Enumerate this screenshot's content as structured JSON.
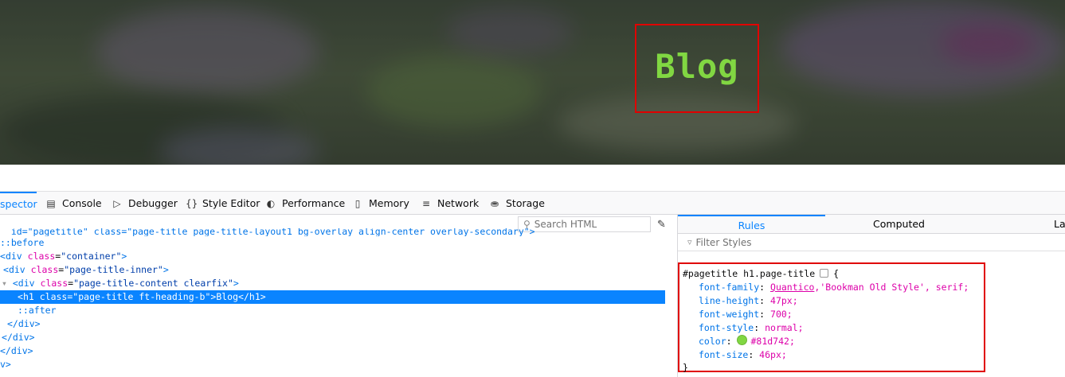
{
  "page": {
    "title": "Blog",
    "title_color": "#81d742"
  },
  "devtools": {
    "tabs": [
      {
        "label": "spector",
        "icon": "",
        "selected": true
      },
      {
        "label": "Console",
        "icon": "console-icon"
      },
      {
        "label": "Debugger",
        "icon": "debugger-icon"
      },
      {
        "label": "Style Editor",
        "icon": "braces-icon"
      },
      {
        "label": "Performance",
        "icon": "gauge-icon"
      },
      {
        "label": "Memory",
        "icon": "memory-chip-icon"
      },
      {
        "label": "Network",
        "icon": "network-icon"
      },
      {
        "label": "Storage",
        "icon": "database-icon"
      }
    ],
    "search_placeholder": "Search HTML",
    "markup": {
      "line0": "  id=\"pagetitle\" class=\"page-title page-title-layout1 bg-overlay align-center overlay-secondary\">",
      "line1": "::before",
      "line2_tag": "div",
      "line2_attr": "class",
      "line2_val": "\"container\"",
      "line3_tag": "div",
      "line3_attr": "class",
      "line3_val": "\"page-title-inner\"",
      "line4_tag": "div",
      "line4_attr": "class",
      "line4_val": "\"page-title-content clearfix\"",
      "line5_tag": "h1",
      "line5_attr": "class",
      "line5_val": "\"page-title ft-heading-b\"",
      "line5_text": "Blog",
      "line6": "::after",
      "line7": "</div>",
      "line8": "/div>",
      "line9": "div>",
      "line10": "v>"
    },
    "rules_tabs": [
      "Rules",
      "Computed",
      "La"
    ],
    "filter_placeholder": "Filter Styles",
    "rule": {
      "selector": "#pagetitle h1.page-title",
      "open_brace": "{",
      "close_brace": "}",
      "declarations": [
        {
          "prop": "font-family",
          "link": "Quantico",
          "rest": ",'Bookman Old Style', serif;"
        },
        {
          "prop": "line-height",
          "value": "47px;"
        },
        {
          "prop": "font-weight",
          "value": "700;"
        },
        {
          "prop": "font-style",
          "value": "normal;"
        },
        {
          "prop": "color",
          "value": "#81d742;"
        },
        {
          "prop": "font-size",
          "value": "46px;"
        }
      ]
    }
  }
}
